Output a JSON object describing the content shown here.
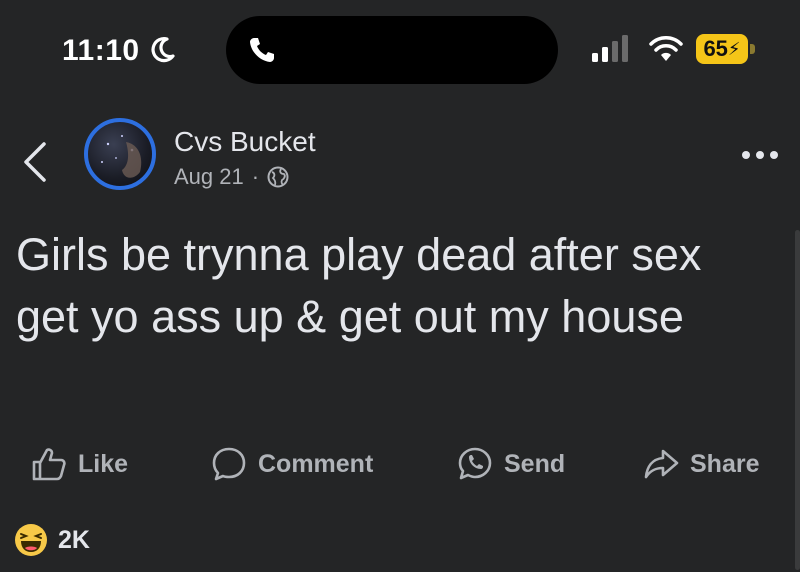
{
  "status_bar": {
    "time": "11:10",
    "battery": "65"
  },
  "post": {
    "author": "Cvs Bucket",
    "date": "Aug 21",
    "separator": "·",
    "text": "Girls be trynna play dead after sex get yo ass up & get out my house"
  },
  "actions": {
    "like": "Like",
    "comment": "Comment",
    "send": "Send",
    "share": "Share"
  },
  "reactions": {
    "count": "2K",
    "icon": "haha-emoji-icon"
  },
  "colors": {
    "background": "#242526",
    "text": "#e4e6eb",
    "muted": "#b0b3b8",
    "avatar_ring": "#2d6fe0",
    "battery": "#f5c518"
  }
}
